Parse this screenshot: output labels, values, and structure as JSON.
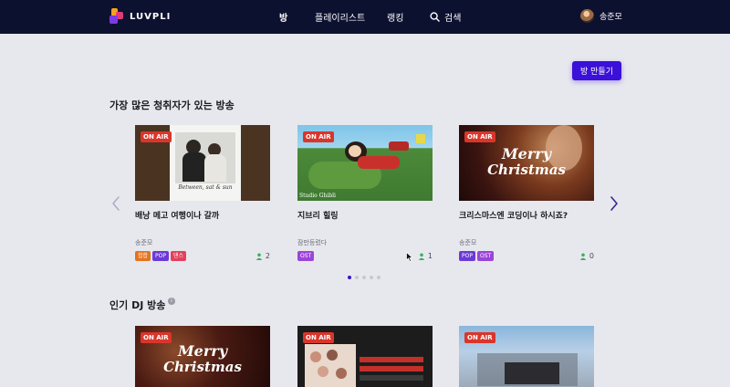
{
  "nav": {
    "logo_text": "LUVPLI",
    "menu": [
      "방",
      "플레이리스트",
      "랭킹",
      "검색"
    ],
    "user_name": "송준모"
  },
  "create_button": "방 만들기",
  "sections": [
    {
      "title": "가장 많은 청취자가 있는 방송"
    },
    {
      "title": "인기 DJ 방송"
    }
  ],
  "badge_on_air": "ON AIR",
  "cards": [
    {
      "title": "배낭 메고 여행이나 갈까",
      "host": "송준모",
      "tags": [
        "힙합",
        "POP",
        "댄스"
      ],
      "listeners": "2",
      "thumb_caption": "Between, sat & sun"
    },
    {
      "title": "지브리 힐링",
      "host": "잠만등렀다",
      "tags": [
        "OST"
      ],
      "listeners": "1",
      "thumb_caption": "Studio Ghibli"
    },
    {
      "title": "크리스마스엔 코딩이나 하시죠?",
      "host": "송준모",
      "tags": [
        "POP",
        "OST"
      ],
      "listeners": "0",
      "thumb_caption_1": "Merry",
      "thumb_caption_2": "Christmas"
    }
  ],
  "dj_cards": [
    {
      "thumb_caption_1": "Merry",
      "thumb_caption_2": "Christmas"
    },
    {
      "thumb_caption": ""
    },
    {
      "thumb_caption": ""
    }
  ],
  "tag_colors": {
    "힙합": "#e5731d",
    "POP": "#6c3ad6",
    "댄스": "#e2415b",
    "OST": "#9b45d8"
  },
  "carousel": {
    "pages": 5,
    "active": 1
  },
  "colors": {
    "nav_bg": "#0d1130",
    "accent": "#3b10d8",
    "on_air": "#d9362b",
    "page_bg": "#e7e8ee"
  }
}
